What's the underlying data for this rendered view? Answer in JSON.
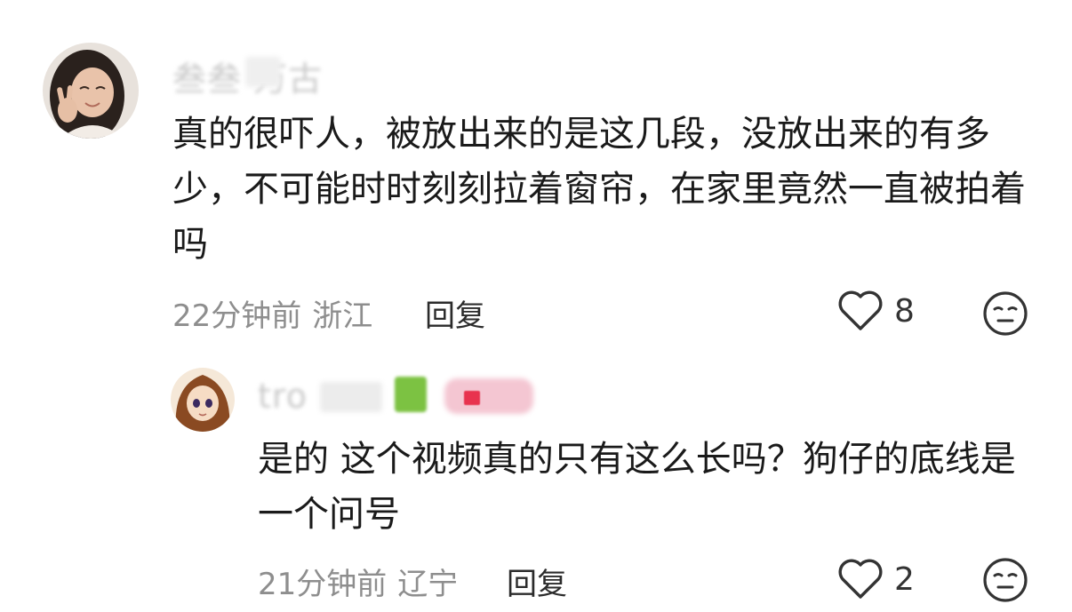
{
  "comments": [
    {
      "username": "叁叁 万古",
      "text": "真的很吓人，被放出来的是这几段，没放出来的有多少，不可能时时刻刻拉着窗帘，在家里竟然一直被拍着吗",
      "time": "22分钟前",
      "location": "浙江",
      "reply_label": "回复",
      "likes": "8",
      "icons": {
        "like": "heart-outline-icon",
        "dislike": "meh-face-icon"
      }
    }
  ],
  "replies": [
    {
      "username": "tro",
      "text": "是的 这个视频真的只有这么长吗？狗仔的底线是一个问号",
      "time": "21分钟前",
      "location": "辽宁",
      "reply_label": "回复",
      "likes": "2",
      "icons": {
        "like": "heart-outline-icon",
        "dislike": "meh-face-icon"
      }
    }
  ],
  "colors": {
    "text": "#1a1a1a",
    "meta": "#8e8e8e",
    "username": "#c9c9c9",
    "badge_green": "#7cc242",
    "badge_pink": "#f4c6d2",
    "badge_red": "#e8334f"
  }
}
